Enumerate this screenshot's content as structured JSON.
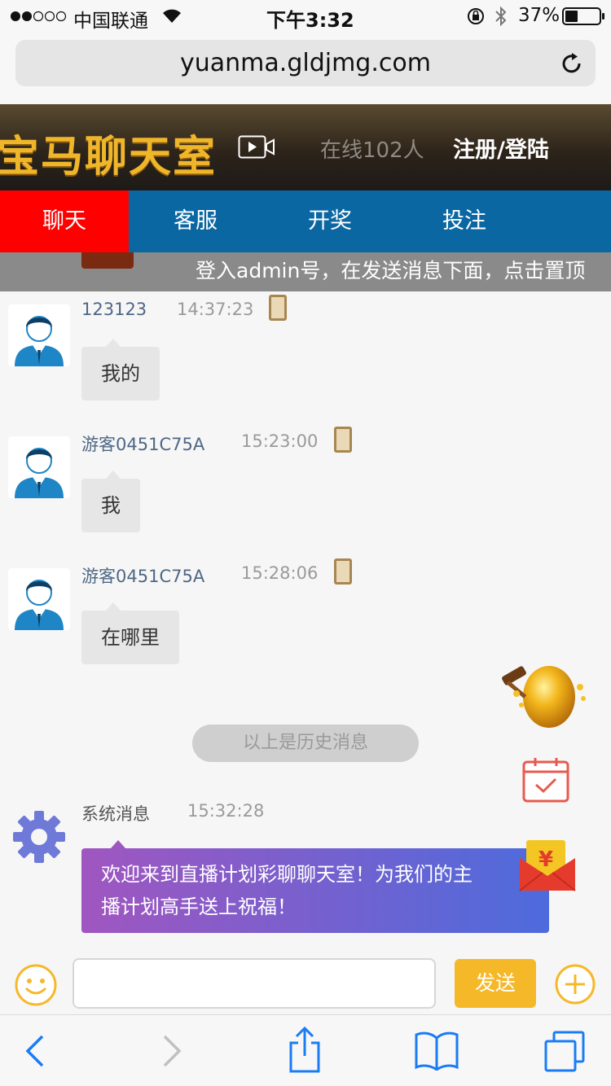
{
  "status_bar": {
    "carrier": "中国联通",
    "time": "下午3:32",
    "battery": "37%",
    "battery_level": 0.37
  },
  "browser": {
    "url": "yuanma.gldjmg.com"
  },
  "header": {
    "logo_text": "宝马聊天室",
    "online_count": "在线102人",
    "login_label": "注册/登陆"
  },
  "nav": {
    "tabs": [
      {
        "label": "聊天",
        "active": true
      },
      {
        "label": "客服",
        "active": false
      },
      {
        "label": "开奖",
        "active": false
      },
      {
        "label": "投注",
        "active": false
      }
    ]
  },
  "ticker": {
    "text": "登入admin号，在发送消息下面，点击置顶"
  },
  "messages": [
    {
      "user": "123123",
      "time": "14:37:23",
      "text": "我的"
    },
    {
      "user": "游客0451C75A",
      "time": "15:23:00",
      "text": "我"
    },
    {
      "user": "游客0451C75A",
      "time": "15:28:06",
      "text": "在哪里"
    }
  ],
  "history_divider": "以上是历史消息",
  "system_message": {
    "user": "系统消息",
    "time": "15:32:28",
    "text_line1": "欢迎来到直播计划彩聊聊天室！为我们的主",
    "text_line2": "播计划高手送上祝福！"
  },
  "composer": {
    "input_value": "",
    "send_label": "发送"
  },
  "colors": {
    "nav_bg": "#0b67a2",
    "active_tab": "#ff0000",
    "send_button": "#f5b829",
    "ios_blue": "#1a7cf5"
  },
  "icons": [
    "signal-dots-icon",
    "wifi-icon",
    "lock-rotation-icon",
    "bluetooth-icon",
    "battery-icon",
    "reload-icon",
    "video-icon",
    "phone-device-icon",
    "gear-icon",
    "golden-egg-icon",
    "calendar-check-icon",
    "red-envelope-icon",
    "smiley-icon",
    "plus-circle-icon",
    "back-icon",
    "forward-icon",
    "share-icon",
    "bookmarks-icon",
    "tabs-icon"
  ]
}
